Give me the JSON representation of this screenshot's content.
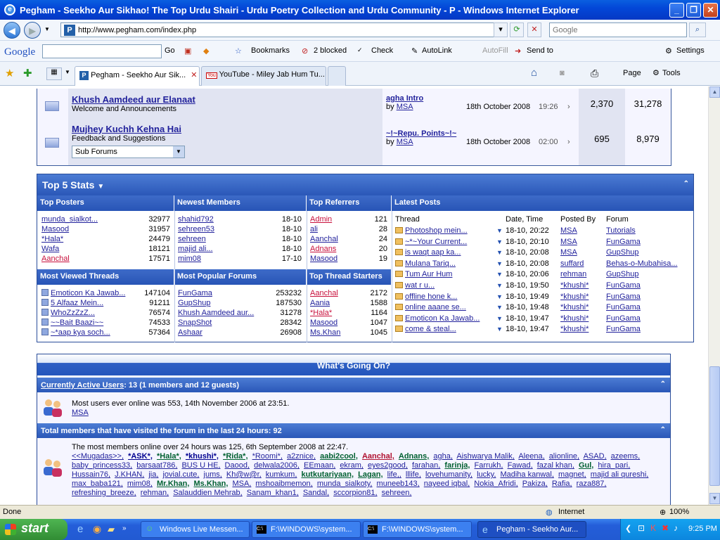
{
  "window": {
    "title": "Pegham - Seekho Aur Sikhao! The Top Urdu Shairi - Urdu Poetry Collection and Urdu Community - P - Windows Internet Explorer",
    "min_label": "_",
    "max_label": "❐",
    "close_label": "✕"
  },
  "address": {
    "url": "http://www.pegham.com/index.php",
    "search_placeholder": "Google",
    "favicon": "P"
  },
  "gtoolbar": {
    "logo": "Google",
    "go": "Go",
    "bookmarks": "Bookmarks",
    "blocked": "2 blocked",
    "check": "Check",
    "autolink": "AutoLink",
    "autofill": "AutoFill",
    "sendto": "Send to",
    "settings": "Settings"
  },
  "tabs": [
    {
      "label": "Pegham - Seekho Aur Sik...",
      "icon": "P"
    },
    {
      "label": "YouTube - Miley Jab Hum Tu...",
      "icon": "You"
    }
  ],
  "cmdbar": {
    "page": "Page",
    "tools": "Tools"
  },
  "forums": [
    {
      "title": "Khush Aamdeed aur Elanaat",
      "desc": "Welcome and Announcements",
      "last_thread": "agha Intro",
      "by_label": "by",
      "last_user": "MSA",
      "last_date": "18th October 2008",
      "last_time": "19:26",
      "threads": "2,370",
      "posts": "31,278"
    },
    {
      "title": "Mujhey Kuchh Kehna Hai",
      "desc": "Feedback and Suggestions",
      "last_thread": "~!~Repu. Points~!~",
      "by_label": "by",
      "last_user": "MSA",
      "last_date": "18th October 2008",
      "last_time": "02:00",
      "threads": "695",
      "posts": "8,979",
      "select": "Sub Forums"
    }
  ],
  "stats": {
    "title": "Top 5 Stats",
    "heads": {
      "top_posters": "Top Posters",
      "newest_members": "Newest Members",
      "top_referrers": "Top Referrers",
      "latest_posts": "Latest Posts",
      "most_viewed": "Most Viewed Threads",
      "most_popular": "Most Popular Forums",
      "top_starters": "Top Thread Starters"
    },
    "top_posters": [
      {
        "name": "munda_sialkot...",
        "n": "32977"
      },
      {
        "name": "Masood",
        "n": "31957"
      },
      {
        "name": "*Hala*",
        "n": "24479"
      },
      {
        "name": "Wafa",
        "n": "18121"
      },
      {
        "name": "Aanchal",
        "n": "17571"
      }
    ],
    "newest_members": [
      {
        "name": "shahid792",
        "d": "18-10"
      },
      {
        "name": "sehreen53",
        "d": "18-10"
      },
      {
        "name": "sehreen",
        "d": "18-10"
      },
      {
        "name": "majid ali...",
        "d": "18-10"
      },
      {
        "name": "mim08",
        "d": "17-10"
      }
    ],
    "top_referrers": [
      {
        "name": "Admin",
        "n": "121"
      },
      {
        "name": "ali",
        "n": "28"
      },
      {
        "name": "Aanchal",
        "n": "24"
      },
      {
        "name": "Adnans",
        "n": "20"
      },
      {
        "name": "Masood",
        "n": "19"
      }
    ],
    "latest_heads": {
      "thread": "Thread",
      "date": "Date, Time",
      "by": "Posted By",
      "forum": "Forum"
    },
    "latest_posts": [
      {
        "thread": "Photoshop mein...",
        "date": "18-10, 20:22",
        "by": "MSA",
        "forum": "Tutorials"
      },
      {
        "thread": "~*~Your Current...",
        "date": "18-10, 20:10",
        "by": "MSA",
        "forum": "FunGama"
      },
      {
        "thread": "is waqt aap ka...",
        "date": "18-10, 20:08",
        "by": "MSA",
        "forum": "GupShup"
      },
      {
        "thread": "Mulana Tariq...",
        "date": "18-10, 20:08",
        "by": "suffard",
        "forum": "Behas-o-Mubahisa..."
      },
      {
        "thread": "Tum Aur Hum",
        "date": "18-10, 20:06",
        "by": "rehman",
        "forum": "GupShup"
      },
      {
        "thread": "wat r u...",
        "date": "18-10, 19:50",
        "by": "*khushi*",
        "forum": "FunGama"
      },
      {
        "thread": "offline hone k...",
        "date": "18-10, 19:49",
        "by": "*khushi*",
        "forum": "FunGama"
      },
      {
        "thread": "online aaane se...",
        "date": "18-10, 19:48",
        "by": "*khushi*",
        "forum": "FunGama"
      },
      {
        "thread": "Emoticon Ka Jawab...",
        "date": "18-10, 19:47",
        "by": "*khushi*",
        "forum": "FunGama"
      },
      {
        "thread": "come & steal...",
        "date": "18-10, 19:47",
        "by": "*khushi*",
        "forum": "FunGama"
      }
    ],
    "most_viewed": [
      {
        "name": "Emoticon Ka Jawab...",
        "n": "147104"
      },
      {
        "name": "5 Alfaaz Mein...",
        "n": "91211"
      },
      {
        "name": "WhoZzZzZ...",
        "n": "76574"
      },
      {
        "name": "~~Bait Baazi~~",
        "n": "74533"
      },
      {
        "name": "~*aap kya soch...",
        "n": "57364"
      }
    ],
    "most_popular": [
      {
        "name": "FunGama",
        "n": "253232"
      },
      {
        "name": "GupShup",
        "n": "187530"
      },
      {
        "name": "Khush Aamdeed aur...",
        "n": "31278"
      },
      {
        "name": "SnapShot",
        "n": "28342"
      },
      {
        "name": "Ashaar",
        "n": "26908"
      }
    ],
    "top_starters": [
      {
        "name": "Aanchal",
        "n": "2172"
      },
      {
        "name": "Aania",
        "n": "1588"
      },
      {
        "name": "*Hala*",
        "n": "1164"
      },
      {
        "name": "Masood",
        "n": "1047"
      },
      {
        "name": "Ms.Khan",
        "n": "1045"
      }
    ]
  },
  "wgo": {
    "title": "What's Going On?",
    "active_link": "Currently Active Users",
    "active_rest": ": 13 (1 members and 12 guests)",
    "most_online": "Most users ever online was 553, 14th November 2006 at 23:51.",
    "active_member": "MSA",
    "visited_title": "Total members that have visited the forum in the last 24 hours: 92",
    "visited_most": "The most members online over 24 hours was 125, 6th September 2008 at 22:47.",
    "members": [
      {
        "t": "<<Mugadas>>,",
        "c": "lnk"
      },
      {
        "t": "*ASK*,",
        "c": "bl"
      },
      {
        "t": "*Hala*,",
        "c": "gr"
      },
      {
        "t": "*khushi*,",
        "c": "bl"
      },
      {
        "t": "*Rida*,",
        "c": "gr"
      },
      {
        "t": "*Roomi*,",
        "c": "lnk"
      },
      {
        "t": "a2znice,",
        "c": "lnk"
      },
      {
        "t": "aabi2cool,",
        "c": "gr"
      },
      {
        "t": "Aanchal,",
        "c": "rd"
      },
      {
        "t": "Adnans,",
        "c": "gr"
      },
      {
        "t": "agha,",
        "c": "lnk"
      },
      {
        "t": "Aishwarya Malik,",
        "c": "lnk"
      },
      {
        "t": "Aleena,",
        "c": "lnk"
      },
      {
        "t": "alionline,",
        "c": "lnk"
      },
      {
        "t": "ASAD,",
        "c": "lnk"
      },
      {
        "t": "azeems,",
        "c": "lnk"
      },
      {
        "t": "baby_princess33,",
        "c": "lnk"
      },
      {
        "t": "barsaat786,",
        "c": "lnk"
      },
      {
        "t": "BUS U HE,",
        "c": "lnk"
      },
      {
        "t": "Daood,",
        "c": "lnk"
      },
      {
        "t": "delwala2006,",
        "c": "lnk"
      },
      {
        "t": "EEmaan,",
        "c": "lnk"
      },
      {
        "t": "ekram,",
        "c": "lnk"
      },
      {
        "t": "eyes2good,",
        "c": "lnk"
      },
      {
        "t": "farahan,",
        "c": "lnk"
      },
      {
        "t": "farinja,",
        "c": "gr"
      },
      {
        "t": "Farrukh,",
        "c": "lnk"
      },
      {
        "t": "Fawad,",
        "c": "lnk"
      },
      {
        "t": "fazal khan,",
        "c": "lnk"
      },
      {
        "t": "Gul,",
        "c": "gr"
      },
      {
        "t": "hira_pari,",
        "c": "lnk"
      },
      {
        "t": "Hussain76,",
        "c": "lnk"
      },
      {
        "t": "J.KHAN,",
        "c": "lnk"
      },
      {
        "t": "jia,",
        "c": "lnk"
      },
      {
        "t": "jovial.cute,",
        "c": "lnk"
      },
      {
        "t": "jums,",
        "c": "lnk"
      },
      {
        "t": "Kh@w@r,",
        "c": "lnk"
      },
      {
        "t": "kumkum,",
        "c": "lnk"
      },
      {
        "t": "kutkutariyaan,",
        "c": "gr"
      },
      {
        "t": "Lagan,",
        "c": "gr"
      },
      {
        "t": "life,,",
        "c": "lnk"
      },
      {
        "t": "lllife,",
        "c": "lnk"
      },
      {
        "t": "lovehumanity,",
        "c": "lnk"
      },
      {
        "t": "lucky,",
        "c": "lnk"
      },
      {
        "t": "Madiha kanwal,",
        "c": "lnk"
      },
      {
        "t": "magnet,",
        "c": "lnk"
      },
      {
        "t": "majid ali qureshi,",
        "c": "lnk"
      },
      {
        "t": "max_baba121,",
        "c": "lnk"
      },
      {
        "t": "mim08,",
        "c": "lnk"
      },
      {
        "t": "Mr.Khan,",
        "c": "gr"
      },
      {
        "t": "Ms.Khan,",
        "c": "gr"
      },
      {
        "t": "MSA,",
        "c": "lnk"
      },
      {
        "t": "mshoaibmemon,",
        "c": "lnk"
      },
      {
        "t": "munda_sialkoty,",
        "c": "lnk"
      },
      {
        "t": "muneeb143,",
        "c": "lnk"
      },
      {
        "t": "nayeed iqbal,",
        "c": "lnk"
      },
      {
        "t": "Nokia_Afridi,",
        "c": "lnk"
      },
      {
        "t": "Pakiza,",
        "c": "lnk"
      },
      {
        "t": "Rafia,",
        "c": "lnk"
      },
      {
        "t": "raza887,",
        "c": "lnk"
      },
      {
        "t": "refreshing_breeze,",
        "c": "lnk"
      },
      {
        "t": "rehman,",
        "c": "lnk"
      },
      {
        "t": "Salauddien Mehrab,",
        "c": "lnk"
      },
      {
        "t": "Sanam_khan1,",
        "c": "lnk"
      },
      {
        "t": "Sandal,",
        "c": "lnk"
      },
      {
        "t": "sccorpion81,",
        "c": "lnk"
      },
      {
        "t": "sehreen,",
        "c": "lnk"
      }
    ]
  },
  "status": {
    "left": "Done",
    "zone": "Internet",
    "zoom": "100%"
  },
  "taskbar": {
    "start": "start",
    "tasks": [
      "Windows Live Messen...",
      "F:\\WINDOWS\\system...",
      "F:\\WINDOWS\\system...",
      "Pegham - Seekho Aur..."
    ],
    "clock": "9:25 PM"
  }
}
